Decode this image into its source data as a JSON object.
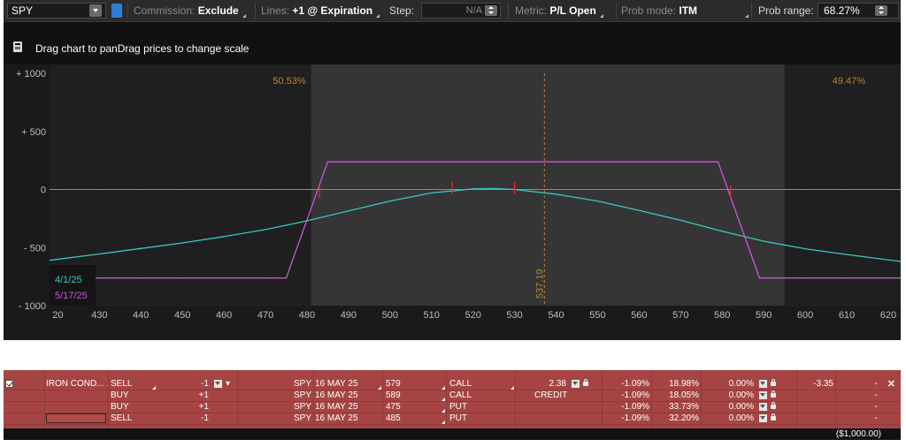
{
  "toolbar": {
    "symbol": "SPY",
    "commission_label": "Commission:",
    "commission_value": "Exclude",
    "lines_label": "Lines:",
    "lines_value": "+1 @ Expiration",
    "step_label": "Step:",
    "step_value": "N/A",
    "metric_label": "Metric:",
    "metric_value": "P/L Open",
    "prob_mode_label": "Prob mode:",
    "prob_mode_value": "ITM",
    "prob_range_label": "Prob range:",
    "prob_range_value": "68.27%"
  },
  "hint": "Drag chart to panDrag prices to change scale",
  "chart_data": {
    "type": "line",
    "xlim": [
      418,
      623
    ],
    "ylim": [
      -1000,
      1000
    ],
    "x_ticks": [
      20,
      430,
      440,
      450,
      460,
      470,
      480,
      490,
      500,
      510,
      520,
      530,
      540,
      550,
      560,
      570,
      580,
      590,
      600,
      610,
      620
    ],
    "y_ticks": [
      1000,
      500,
      0,
      -500,
      -1000
    ],
    "y_tick_labels": [
      "+ 1000",
      "+ 500",
      "0",
      "- 500",
      "- 1000"
    ],
    "prob_band": [
      481,
      595
    ],
    "prob_left": "50.53%",
    "prob_right": "49.47%",
    "current_price": 537.19,
    "current_price_label": "537.19",
    "grid": true,
    "legend": "bottom-left",
    "series": [
      {
        "name": "4/1/25",
        "color": "#38c8c0",
        "x": [
          418,
          430,
          440,
          450,
          460,
          470,
          480,
          490,
          500,
          510,
          520,
          525,
          530,
          540,
          550,
          560,
          570,
          580,
          590,
          600,
          610,
          623
        ],
        "y": [
          -610,
          -555,
          -508,
          -460,
          -405,
          -345,
          -270,
          -185,
          -100,
          -30,
          5,
          8,
          0,
          -40,
          -100,
          -180,
          -265,
          -360,
          -445,
          -510,
          -560,
          -620
        ]
      },
      {
        "name": "5/17/25",
        "color": "#cc55dd",
        "x": [
          418,
          475,
          485,
          579,
          589,
          623
        ],
        "y": [
          -762,
          -762,
          238,
          238,
          -762,
          -762
        ]
      }
    ],
    "breakeven_marks": [
      {
        "x": 483,
        "y": -20
      },
      {
        "x": 515,
        "y": 15
      },
      {
        "x": 530,
        "y": 15
      },
      {
        "x": 582,
        "y": -20
      }
    ]
  },
  "table": {
    "rows": [
      {
        "spread": "IRON COND...",
        "side": "SELL",
        "qty": "-1",
        "sym": "SPY",
        "exp": "16 MAY 25",
        "strike": "579",
        "type": "CALL",
        "price": "2.38",
        "delta": "-1.09%",
        "prob": "18.98%",
        "pct": "0.00%",
        "pl": "-3.35",
        "dash": "-"
      },
      {
        "spread": "",
        "side": "BUY",
        "qty": "+1",
        "sym": "SPY",
        "exp": "16 MAY 25",
        "strike": "589",
        "type": "CALL",
        "price": "CREDIT",
        "delta": "-1.09%",
        "prob": "18.05%",
        "pct": "0.00%",
        "pl": "",
        "dash": "-"
      },
      {
        "spread": "",
        "side": "BUY",
        "qty": "+1",
        "sym": "SPY",
        "exp": "16 MAY 25",
        "strike": "475",
        "type": "PUT",
        "price": "",
        "delta": "-1.09%",
        "prob": "33.73%",
        "pct": "0.00%",
        "pl": "",
        "dash": "-"
      },
      {
        "spread": "",
        "side": "SELL",
        "qty": "-1",
        "sym": "SPY",
        "exp": "16 MAY 25",
        "strike": "485",
        "type": "PUT",
        "price": "",
        "delta": "-1.09%",
        "prob": "32.20%",
        "pct": "0.00%",
        "pl": "",
        "dash": "-"
      }
    ],
    "footer_total": "($1,000.00)"
  },
  "colors": {
    "app_bg": "#1a1a1a",
    "band_bg": "#353535",
    "prob_text": "#b8862e",
    "row_red": "#a64444",
    "expiration_line": "#cc55dd",
    "date_line": "#38c8c0"
  }
}
